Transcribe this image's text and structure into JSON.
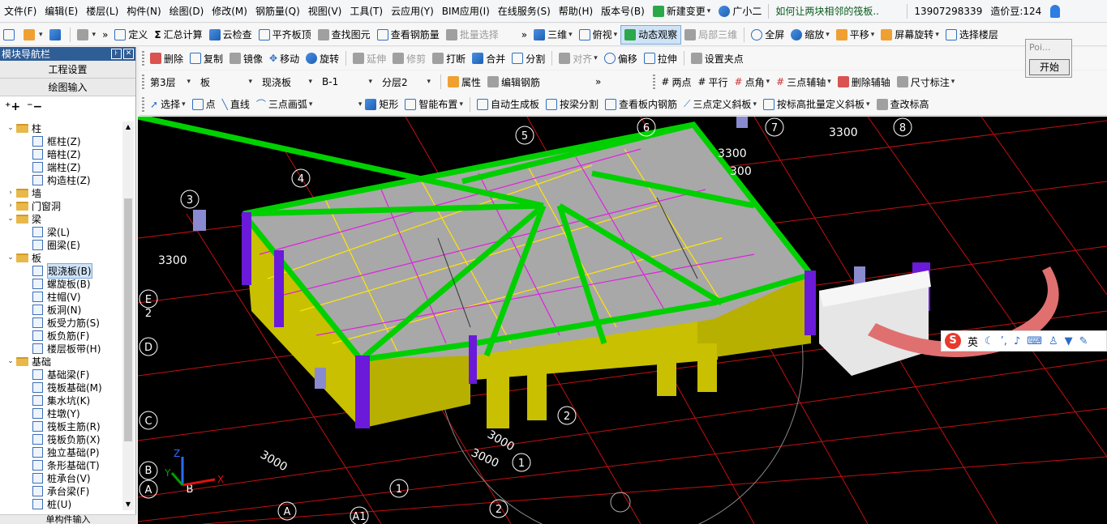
{
  "menubar": {
    "items": [
      "文件(F)",
      "编辑(E)",
      "楼层(L)",
      "构件(N)",
      "绘图(D)",
      "修改(M)",
      "钢筋量(Q)",
      "视图(V)",
      "工具(T)",
      "云应用(Y)",
      "BIM应用(I)",
      "在线服务(S)",
      "帮助(H)",
      "版本号(B)"
    ],
    "new_change": "新建变更",
    "assistant": "广小二",
    "tip": "如何让两块相邻的筏板..",
    "phone": "13907298339",
    "beans": "造价豆:124"
  },
  "toolbar1": {
    "define": "定义",
    "sum": "汇总计算",
    "cloud_check": "云检查",
    "flush_slab": "平齐板顶",
    "find": "查找图元",
    "view_rebar": "查看钢筋量",
    "batch_select": "批量选择",
    "view3d": "三维",
    "top_view": "俯视",
    "dynamic_observe": "动态观察",
    "local3d": "局部三维",
    "fullscreen": "全屏",
    "zoom": "缩放",
    "pan": "平移",
    "screen_rotate": "屏幕旋转",
    "select_floor": "选择楼层"
  },
  "toolbar2": {
    "delete": "删除",
    "copy": "复制",
    "mirror": "镜像",
    "move": "移动",
    "rotate": "旋转",
    "extend": "延伸",
    "trim": "修剪",
    "break": "打断",
    "merge": "合并",
    "split": "分割",
    "align": "对齐",
    "offset": "偏移",
    "stretch": "拉伸",
    "set_grip": "设置夹点"
  },
  "toolbar3": {
    "floor": "第3层",
    "category": "板",
    "type": "现浇板",
    "name": "B-1",
    "layer": "分层2",
    "attribute": "属性",
    "edit_rebar": "编辑钢筋",
    "two_point": "两点",
    "parallel": "平行",
    "point_angle": "点角",
    "three_point_axis": "三点辅轴",
    "delete_axis": "删除辅轴",
    "dimension": "尺寸标注"
  },
  "toolbar4": {
    "select": "选择",
    "point": "点",
    "line": "直线",
    "arc": "三点画弧",
    "rect": "矩形",
    "smart_layout": "智能布置",
    "auto_gen": "自动生成板",
    "beam_split": "按梁分割",
    "view_slab_rebar": "查看板内钢筋",
    "three_point_slope": "三点定义斜板",
    "batch_slope": "按标高批量定义斜板",
    "check_elev": "查改标高"
  },
  "panel": {
    "title": "模块导航栏",
    "pin": "꜔",
    "close": "✕",
    "tab1": "工程设置",
    "tab2": "绘图输入",
    "bottom": "单构件输入",
    "tree": [
      {
        "level": 0,
        "label": "柱",
        "folder": true,
        "expanded": true
      },
      {
        "level": 1,
        "label": "框柱(Z)"
      },
      {
        "level": 1,
        "label": "暗柱(Z)"
      },
      {
        "level": 1,
        "label": "端柱(Z)"
      },
      {
        "level": 1,
        "label": "构造柱(Z)"
      },
      {
        "level": 0,
        "label": "墙",
        "folder": true,
        "expanded": false
      },
      {
        "level": 0,
        "label": "门窗洞",
        "folder": true,
        "expanded": false
      },
      {
        "level": 0,
        "label": "梁",
        "folder": true,
        "expanded": true
      },
      {
        "level": 1,
        "label": "梁(L)"
      },
      {
        "level": 1,
        "label": "圈梁(E)"
      },
      {
        "level": 0,
        "label": "板",
        "folder": true,
        "expanded": true
      },
      {
        "level": 1,
        "label": "现浇板(B)",
        "selected": true
      },
      {
        "level": 1,
        "label": "螺旋板(B)"
      },
      {
        "level": 1,
        "label": "柱帽(V)"
      },
      {
        "level": 1,
        "label": "板洞(N)"
      },
      {
        "level": 1,
        "label": "板受力筋(S)"
      },
      {
        "level": 1,
        "label": "板负筋(F)"
      },
      {
        "level": 1,
        "label": "楼层板带(H)"
      },
      {
        "level": 0,
        "label": "基础",
        "folder": true,
        "expanded": true
      },
      {
        "level": 1,
        "label": "基础梁(F)"
      },
      {
        "level": 1,
        "label": "筏板基础(M)"
      },
      {
        "level": 1,
        "label": "集水坑(K)"
      },
      {
        "level": 1,
        "label": "柱墩(Y)"
      },
      {
        "level": 1,
        "label": "筏板主筋(R)"
      },
      {
        "level": 1,
        "label": "筏板负筋(X)"
      },
      {
        "level": 1,
        "label": "独立基础(P)"
      },
      {
        "level": 1,
        "label": "条形基础(T)"
      },
      {
        "level": 1,
        "label": "桩承台(V)"
      },
      {
        "level": 1,
        "label": "承台梁(F)"
      },
      {
        "level": 1,
        "label": "桩(U)"
      }
    ]
  },
  "popup": {
    "text": "Poi...",
    "button": "开始"
  },
  "ime": {
    "lang": "英"
  },
  "viewport": {
    "axis_numbers": [
      "1",
      "2",
      "2",
      "3",
      "4",
      "5",
      "6",
      "7",
      "8",
      "1"
    ],
    "axis_letters": [
      "A",
      "A1",
      "B",
      "B",
      "C",
      "D",
      "E",
      "2",
      "A"
    ],
    "dims": [
      "3300",
      "3300",
      "3300",
      "3000",
      "3000",
      "3000",
      "3300",
      "300"
    ],
    "coord_x": "X",
    "coord_y": "Y",
    "coord_z": "Z",
    "coord_b": "B"
  }
}
